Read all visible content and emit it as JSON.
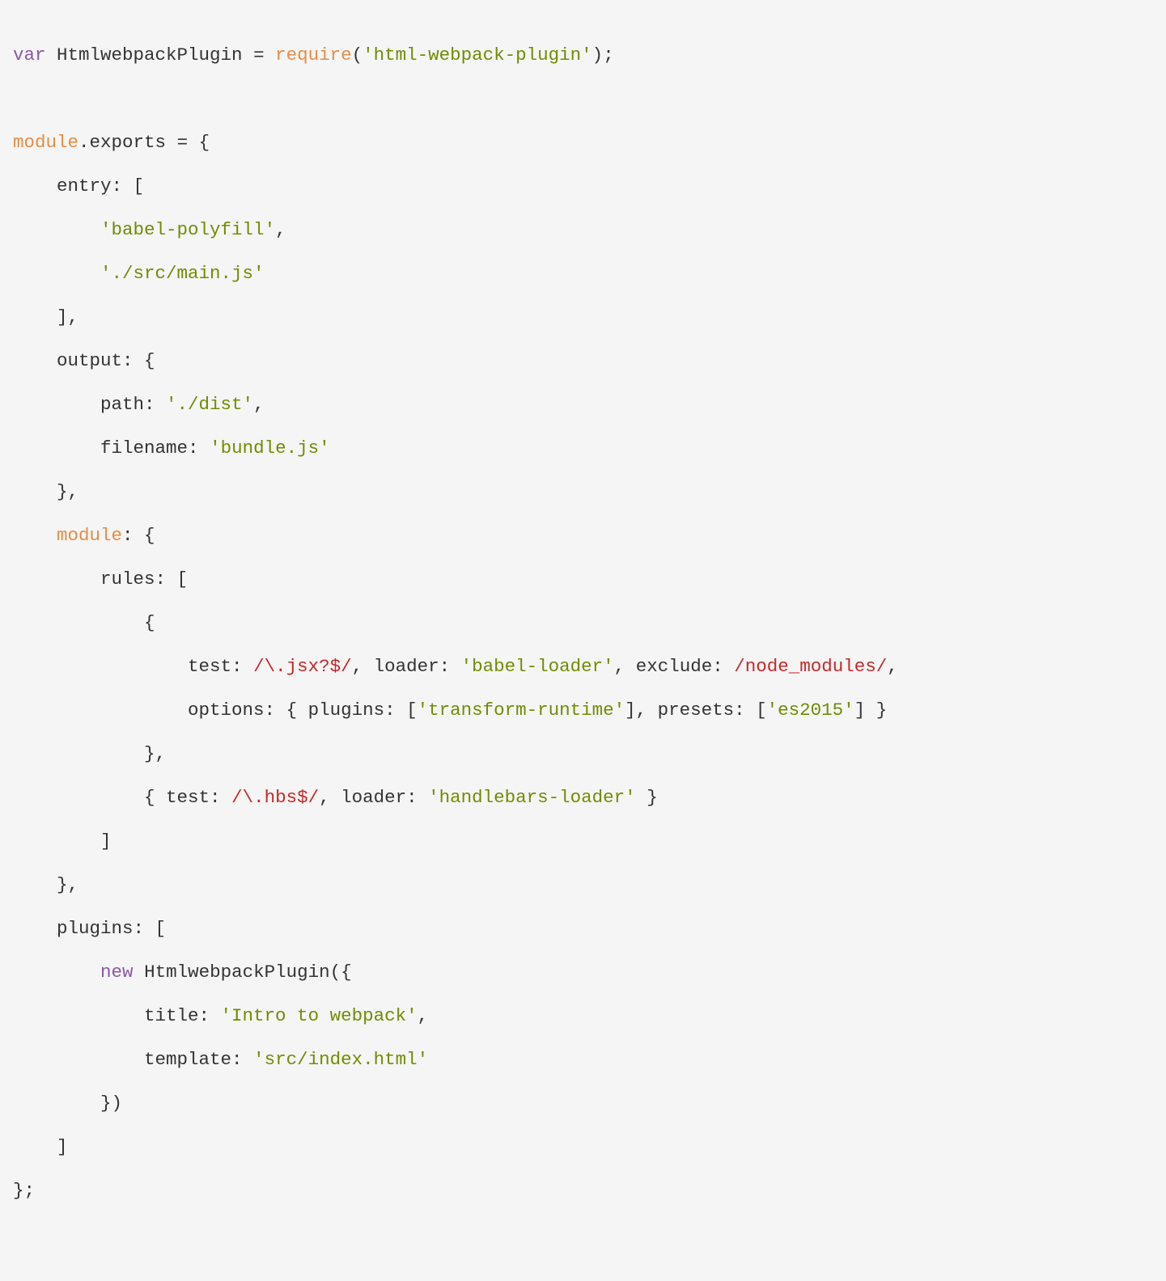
{
  "code": {
    "l01": {
      "kw_var": "var",
      "id": " HtmlwebpackPlugin ",
      "eq": "=",
      "sp": " ",
      "fn": "require",
      "op": "(",
      "str": "'html-webpack-plugin'",
      "cp": ")",
      "semi": ";"
    },
    "l02_blank": "",
    "l03": {
      "builtin": "module",
      "dot": ".",
      "exports": "exports ",
      "eq": "=",
      "sp": " ",
      "brace": "{"
    },
    "l04": {
      "indent": "    ",
      "prop": "entry: ",
      "br": "["
    },
    "l05": {
      "indent": "        ",
      "str": "'babel-polyfill'",
      "comma": ","
    },
    "l06": {
      "indent": "        ",
      "str": "'./src/main.js'"
    },
    "l07": {
      "indent": "    ",
      "br": "]",
      "comma": ","
    },
    "l08": {
      "indent": "    ",
      "prop": "output: ",
      "brace": "{"
    },
    "l09": {
      "indent": "        ",
      "prop": "path: ",
      "str": "'./dist'",
      "comma": ","
    },
    "l10": {
      "indent": "        ",
      "prop": "filename: ",
      "str": "'bundle.js'"
    },
    "l11": {
      "indent": "    ",
      "brace": "}",
      "comma": ","
    },
    "l12": {
      "indent": "    ",
      "builtin": "module",
      "rest": ": ",
      "brace": "{"
    },
    "l13": {
      "indent": "        ",
      "prop": "rules: ",
      "br": "["
    },
    "l14": {
      "indent": "            ",
      "brace": "{"
    },
    "l15": {
      "indent": "                ",
      "p1": "test: ",
      "regex": "/\\.jsx?$/",
      "c1": ", ",
      "p2": "loader: ",
      "str1": "'babel-loader'",
      "c2": ", ",
      "p3": "exclude: ",
      "regex2": "/node_modules/",
      "comma": ","
    },
    "l16": {
      "indent": "                ",
      "p1": "options: { plugins: [",
      "str1": "'transform-runtime'",
      "mid": "], presets: [",
      "str2": "'es2015'",
      "end": "] }"
    },
    "l17": {
      "indent": "            ",
      "brace": "}",
      "comma": ","
    },
    "l18": {
      "indent": "            ",
      "open": "{ ",
      "p1": "test: ",
      "regex": "/\\.hbs$/",
      "c1": ", ",
      "p2": "loader: ",
      "str": "'handlebars-loader'",
      "end": " }"
    },
    "l19": {
      "indent": "        ",
      "br": "]"
    },
    "l20": {
      "indent": "    ",
      "brace": "}",
      "comma": ","
    },
    "l21": {
      "indent": "    ",
      "prop": "plugins: ",
      "br": "["
    },
    "l22": {
      "indent": "        ",
      "kw_new": "new",
      "sp": " ",
      "cls": "HtmlwebpackPlugin(",
      "brace": "{"
    },
    "l23": {
      "indent": "            ",
      "prop": "title: ",
      "str": "'Intro to webpack'",
      "comma": ","
    },
    "l24": {
      "indent": "            ",
      "prop": "template: ",
      "str": "'src/index.html'"
    },
    "l25": {
      "indent": "        ",
      "brace": "}",
      "paren": ")"
    },
    "l26": {
      "indent": "    ",
      "br": "]"
    },
    "l27": {
      "brace": "}",
      "semi": ";"
    }
  }
}
